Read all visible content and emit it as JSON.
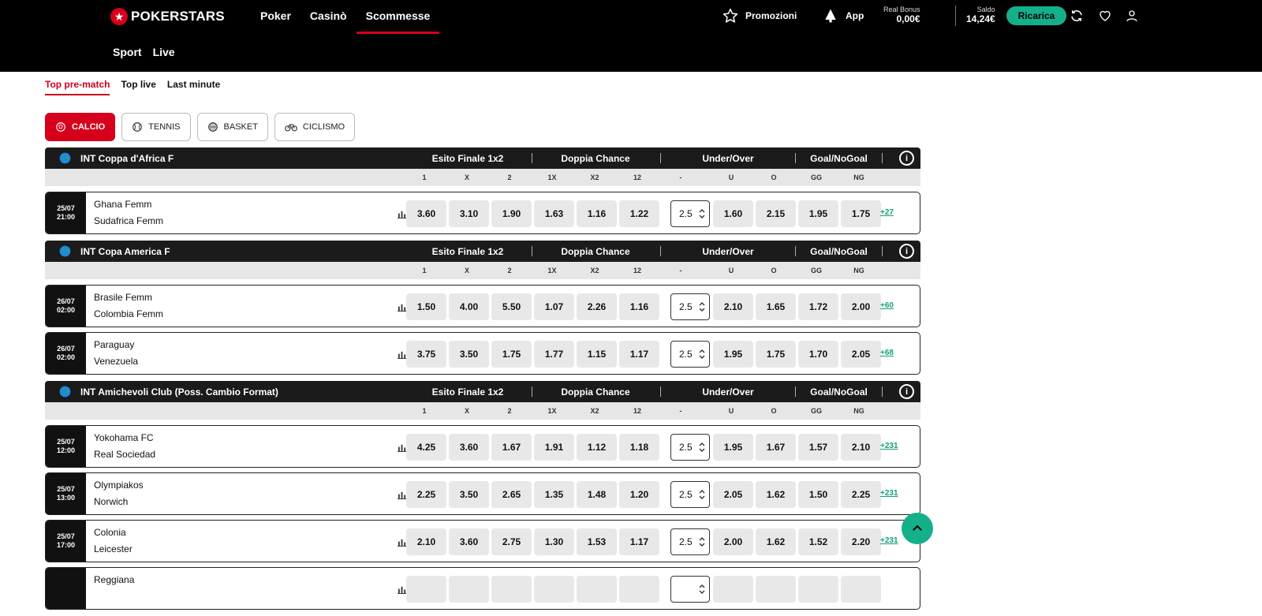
{
  "header": {
    "brand": "POKERSTARS",
    "main_nav": [
      {
        "label": "Poker",
        "active": false
      },
      {
        "label": "Casinò",
        "active": false
      },
      {
        "label": "Scommesse",
        "active": true
      }
    ],
    "sub_nav": [
      {
        "label": "Sport"
      },
      {
        "label": "Live"
      }
    ],
    "promotions": "Promozioni",
    "app": "App",
    "real_bonus_label": "Real Bonus",
    "real_bonus_value": "0,00€",
    "balance_label": "Saldo",
    "balance_value": "14,24€",
    "topup_button": "Ricarica",
    "icons": [
      "star-icon",
      "app-icon",
      "refresh-icon",
      "heart-icon",
      "user-icon"
    ]
  },
  "tabs": [
    {
      "label": "Top pre-match",
      "active": true
    },
    {
      "label": "Top live",
      "active": false
    },
    {
      "label": "Last minute",
      "active": false
    }
  ],
  "sports": [
    {
      "label": "CALCIO",
      "active": true,
      "icon": "soccer-ball-icon"
    },
    {
      "label": "TENNIS",
      "active": false,
      "icon": "tennis-ball-icon"
    },
    {
      "label": "BASKET",
      "active": false,
      "icon": "basketball-icon"
    },
    {
      "label": "CICLISMO",
      "active": false,
      "icon": "bicycle-icon"
    }
  ],
  "market_groups": [
    "Esito Finale 1x2",
    "Doppia Chance",
    "Under/Over",
    "Goal/NoGoal"
  ],
  "market_columns": [
    "1",
    "X",
    "2",
    "1X",
    "X2",
    "12",
    "-",
    "U",
    "O",
    "GG",
    "NG"
  ],
  "leagues": [
    {
      "name": "INT Coppa d'Africa F",
      "matches": [
        {
          "date": "25/07",
          "time": "21:00",
          "home": "Ghana Femm",
          "away": "Sudafrica Femm",
          "odds": [
            "3.60",
            "3.10",
            "1.90",
            "1.63",
            "1.16",
            "1.22"
          ],
          "line": "2.5",
          "uo": [
            "1.60",
            "2.15"
          ],
          "gg": [
            "1.95",
            "1.75"
          ],
          "more": "+27"
        }
      ]
    },
    {
      "name": "INT Copa America F",
      "matches": [
        {
          "date": "26/07",
          "time": "02:00",
          "home": "Brasile Femm",
          "away": "Colombia Femm",
          "odds": [
            "1.50",
            "4.00",
            "5.50",
            "1.07",
            "2.26",
            "1.16"
          ],
          "line": "2.5",
          "uo": [
            "2.10",
            "1.65"
          ],
          "gg": [
            "1.72",
            "2.00"
          ],
          "more": "+60"
        },
        {
          "date": "26/07",
          "time": "02:00",
          "home": "Paraguay",
          "away": "Venezuela",
          "odds": [
            "3.75",
            "3.50",
            "1.75",
            "1.77",
            "1.15",
            "1.17"
          ],
          "line": "2.5",
          "uo": [
            "1.95",
            "1.75"
          ],
          "gg": [
            "1.70",
            "2.05"
          ],
          "more": "+68"
        }
      ]
    },
    {
      "name": "INT Amichevoli Club (Poss. Cambio Format)",
      "matches": [
        {
          "date": "25/07",
          "time": "12:00",
          "home": "Yokohama FC",
          "away": "Real Sociedad",
          "odds": [
            "4.25",
            "3.60",
            "1.67",
            "1.91",
            "1.12",
            "1.18"
          ],
          "line": "2.5",
          "uo": [
            "1.95",
            "1.67"
          ],
          "gg": [
            "1.57",
            "2.10"
          ],
          "more": "+231"
        },
        {
          "date": "25/07",
          "time": "13:00",
          "home": "Olympiakos",
          "away": "Norwich",
          "odds": [
            "2.25",
            "3.50",
            "2.65",
            "1.35",
            "1.48",
            "1.20"
          ],
          "line": "2.5",
          "uo": [
            "2.05",
            "1.62"
          ],
          "gg": [
            "1.50",
            "2.25"
          ],
          "more": "+231"
        },
        {
          "date": "25/07",
          "time": "17:00",
          "home": "Colonia",
          "away": "Leicester",
          "odds": [
            "2.10",
            "3.60",
            "2.75",
            "1.30",
            "1.53",
            "1.17"
          ],
          "line": "2.5",
          "uo": [
            "2.00",
            "1.62"
          ],
          "gg": [
            "1.52",
            "2.20"
          ],
          "more": "+231"
        },
        {
          "date": "",
          "time": "",
          "home": "Reggiana",
          "away": "",
          "odds": [
            "",
            "",
            "",
            "",
            "",
            ""
          ],
          "line": "",
          "uo": [
            "",
            ""
          ],
          "gg": [
            "",
            ""
          ],
          "more": ""
        }
      ]
    }
  ],
  "colors": {
    "brand_red": "#d6001c",
    "accent_green": "#14b08a",
    "dark": "#1b1b1b"
  }
}
